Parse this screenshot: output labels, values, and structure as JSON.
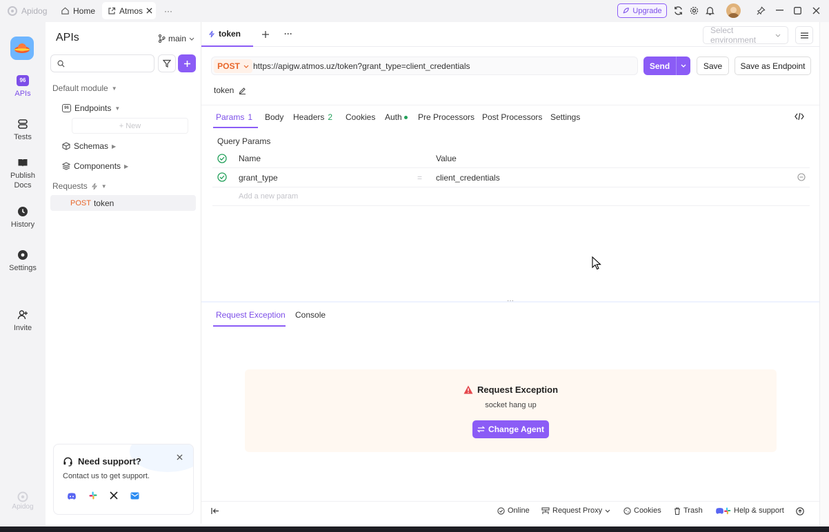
{
  "titlebar": {
    "app_name": "Apidog",
    "home_tab": "Home",
    "project_tab": "Atmos",
    "more": "···",
    "upgrade": "Upgrade"
  },
  "rail": {
    "items": [
      {
        "label": "APIs"
      },
      {
        "label": "Tests"
      },
      {
        "label": "Publish Docs"
      },
      {
        "label": "History"
      },
      {
        "label": "Settings"
      },
      {
        "label": "Invite"
      }
    ],
    "footer_logo": "Apidog"
  },
  "apipanel": {
    "title": "APIs",
    "branch": "main",
    "search_placeholder": "",
    "default_module": "Default module",
    "endpoints": "Endpoints",
    "new_label": "+ New",
    "schemas": "Schemas",
    "components": "Components",
    "requests": "Requests",
    "request_method": "POST",
    "request_name": "token",
    "support": {
      "title": "Need support?",
      "text": "Contact us to get support."
    }
  },
  "editor": {
    "tab_label": "token",
    "env_placeholder": "Select environment",
    "method": "POST",
    "url": "https://apigw.atmos.uz/token?grant_type=client_credentials",
    "send": "Send",
    "save": "Save",
    "save_endpoint": "Save as Endpoint",
    "request_name": "token",
    "tabs": [
      {
        "label": "Params",
        "count": "1"
      },
      {
        "label": "Body",
        "count": ""
      },
      {
        "label": "Headers",
        "count": "2"
      },
      {
        "label": "Cookies",
        "count": ""
      },
      {
        "label": "Auth",
        "count": ""
      },
      {
        "label": "Pre Processors",
        "count": ""
      },
      {
        "label": "Post Processors",
        "count": ""
      },
      {
        "label": "Settings",
        "count": ""
      }
    ],
    "query_params_label": "Query Params",
    "col_name": "Name",
    "col_value": "Value",
    "param": {
      "name": "grant_type",
      "eq": "=",
      "value": "client_credentials"
    },
    "add_param_placeholder": "Add a new param"
  },
  "response": {
    "tabs": [
      "Request Exception",
      "Console"
    ],
    "error_title": "Request Exception",
    "error_message": "socket hang up",
    "change_agent": "Change Agent"
  },
  "statusbar": {
    "online": "Online",
    "proxy": "Request Proxy",
    "cookies": "Cookies",
    "trash": "Trash",
    "help": "Help & support"
  },
  "colors": {
    "accent": "#8b5cf6",
    "post": "#e8662a",
    "success": "#22a05a",
    "danger": "#e5484d",
    "error_bg": "#fff8f1"
  }
}
